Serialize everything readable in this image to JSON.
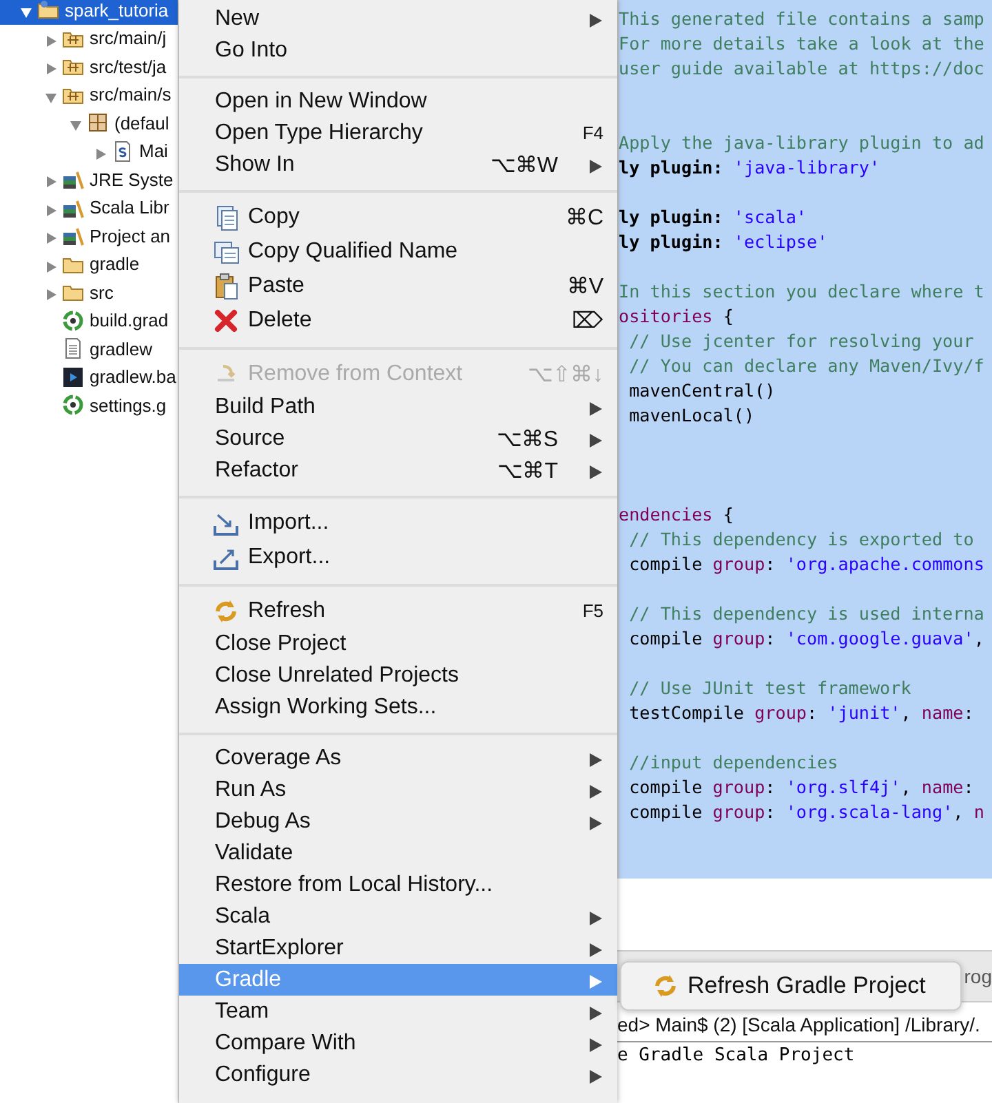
{
  "tree": [
    {
      "label": "spark_tutoria",
      "kind": "project",
      "selected": true,
      "expanded": true,
      "children": [
        {
          "label": "src/main/j",
          "kind": "package-folder",
          "selected": false,
          "expanded": false
        },
        {
          "label": "src/test/ja",
          "kind": "package-folder",
          "selected": false,
          "expanded": false
        },
        {
          "label": "src/main/s",
          "kind": "package-folder",
          "selected": false,
          "expanded": true,
          "children": [
            {
              "label": "(defaul",
              "kind": "package",
              "selected": false,
              "expanded": true,
              "children": [
                {
                  "label": "Mai",
                  "kind": "scala-file",
                  "selected": false,
                  "expanded": false
                }
              ]
            }
          ]
        },
        {
          "label": "JRE Syste",
          "kind": "library",
          "selected": false,
          "expanded": false
        },
        {
          "label": "Scala Libr",
          "kind": "library",
          "selected": false,
          "expanded": false
        },
        {
          "label": "Project an",
          "kind": "library",
          "selected": false,
          "expanded": false
        },
        {
          "label": "gradle",
          "kind": "folder",
          "selected": false,
          "expanded": false
        },
        {
          "label": "src",
          "kind": "folder",
          "selected": false,
          "expanded": false
        },
        {
          "label": "build.grad",
          "kind": "gradle-file",
          "selected": false
        },
        {
          "label": "gradlew",
          "kind": "text-file",
          "selected": false
        },
        {
          "label": "gradlew.ba",
          "kind": "script-file",
          "selected": false
        },
        {
          "label": "settings.g",
          "kind": "gradle-file",
          "selected": false
        }
      ]
    }
  ],
  "editor": {
    "lines": [
      {
        "kind": "code",
        "tokens": [
          {
            "kind": "comment",
            "text": "This generated file contains a samp"
          }
        ]
      },
      {
        "kind": "code",
        "tokens": [
          {
            "kind": "comment",
            "text": "For more details take a look at the"
          }
        ]
      },
      {
        "kind": "code",
        "tokens": [
          {
            "kind": "comment",
            "text": "user guide available at https://doc"
          }
        ]
      },
      {
        "kind": "blank"
      },
      {
        "kind": "blank"
      },
      {
        "kind": "code",
        "tokens": [
          {
            "kind": "comment",
            "text": "Apply the java-library plugin to ad"
          }
        ]
      },
      {
        "kind": "code",
        "tokens": [
          {
            "kind": "keyword",
            "text": "ly plugin: "
          },
          {
            "kind": "string",
            "text": "'java-library'"
          }
        ]
      },
      {
        "kind": "blank"
      },
      {
        "kind": "code",
        "tokens": [
          {
            "kind": "keyword",
            "text": "ly plugin: "
          },
          {
            "kind": "string",
            "text": "'scala'"
          }
        ]
      },
      {
        "kind": "code",
        "tokens": [
          {
            "kind": "keyword",
            "text": "ly plugin: "
          },
          {
            "kind": "string",
            "text": "'eclipse'"
          }
        ]
      },
      {
        "kind": "blank"
      },
      {
        "kind": "code",
        "tokens": [
          {
            "kind": "comment",
            "text": "In this section you declare where t"
          }
        ]
      },
      {
        "kind": "code",
        "tokens": [
          {
            "kind": "name",
            "text": "ositories"
          },
          {
            "kind": "plain",
            "text": " {"
          }
        ]
      },
      {
        "kind": "code",
        "tokens": [
          {
            "kind": "comment",
            "text": " // Use jcenter for resolving your"
          }
        ]
      },
      {
        "kind": "code",
        "tokens": [
          {
            "kind": "comment",
            "text": " // You can declare any Maven/Ivy/f"
          }
        ]
      },
      {
        "kind": "code",
        "tokens": [
          {
            "kind": "plain",
            "text": " mavenCentral()"
          }
        ]
      },
      {
        "kind": "code",
        "tokens": [
          {
            "kind": "plain",
            "text": " mavenLocal()"
          }
        ]
      },
      {
        "kind": "blank"
      },
      {
        "kind": "blank"
      },
      {
        "kind": "blank"
      },
      {
        "kind": "code",
        "tokens": [
          {
            "kind": "name",
            "text": "endencies"
          },
          {
            "kind": "plain",
            "text": " {"
          }
        ]
      },
      {
        "kind": "code",
        "tokens": [
          {
            "kind": "comment",
            "text": " // This dependency is exported to"
          }
        ]
      },
      {
        "kind": "code",
        "tokens": [
          {
            "kind": "plain",
            "text": " compile "
          },
          {
            "kind": "name",
            "text": "group"
          },
          {
            "kind": "plain",
            "text": ": "
          },
          {
            "kind": "string",
            "text": "'org.apache.commons"
          }
        ]
      },
      {
        "kind": "blank"
      },
      {
        "kind": "code",
        "tokens": [
          {
            "kind": "comment",
            "text": " // This dependency is used interna"
          }
        ]
      },
      {
        "kind": "code",
        "tokens": [
          {
            "kind": "plain",
            "text": " compile "
          },
          {
            "kind": "name",
            "text": "group"
          },
          {
            "kind": "plain",
            "text": ": "
          },
          {
            "kind": "string",
            "text": "'com.google.guava'"
          },
          {
            "kind": "plain",
            "text": ","
          }
        ]
      },
      {
        "kind": "blank"
      },
      {
        "kind": "code",
        "tokens": [
          {
            "kind": "comment",
            "text": " // Use JUnit test framework"
          }
        ]
      },
      {
        "kind": "code",
        "tokens": [
          {
            "kind": "plain",
            "text": " testCompile "
          },
          {
            "kind": "name",
            "text": "group"
          },
          {
            "kind": "plain",
            "text": ": "
          },
          {
            "kind": "string",
            "text": "'junit'"
          },
          {
            "kind": "plain",
            "text": ", "
          },
          {
            "kind": "name",
            "text": "name"
          },
          {
            "kind": "plain",
            "text": ":"
          }
        ]
      },
      {
        "kind": "blank"
      },
      {
        "kind": "code",
        "tokens": [
          {
            "kind": "comment",
            "text": " //input dependencies"
          }
        ]
      },
      {
        "kind": "code",
        "tokens": [
          {
            "kind": "plain",
            "text": " compile "
          },
          {
            "kind": "name",
            "text": "group"
          },
          {
            "kind": "plain",
            "text": ": "
          },
          {
            "kind": "string",
            "text": "'org.slf4j'"
          },
          {
            "kind": "plain",
            "text": ", "
          },
          {
            "kind": "name",
            "text": "name"
          },
          {
            "kind": "plain",
            "text": ":"
          }
        ]
      },
      {
        "kind": "code",
        "tokens": [
          {
            "kind": "plain",
            "text": " compile "
          },
          {
            "kind": "name",
            "text": "group"
          },
          {
            "kind": "plain",
            "text": ": "
          },
          {
            "kind": "string",
            "text": "'org.scala-lang'"
          },
          {
            "kind": "plain",
            "text": ", "
          },
          {
            "kind": "name",
            "text": "n"
          }
        ]
      }
    ]
  },
  "bottom_panel": {
    "tab_label": "rog",
    "console_header": "ed> Main$ (2) [Scala Application] /Library/.",
    "console_output": "e Gradle Scala Project"
  },
  "context_menu": {
    "items": [
      {
        "kind": "item",
        "label": "New",
        "submenu": true,
        "disabled": false,
        "selected": false
      },
      {
        "kind": "item",
        "label": "Go Into",
        "submenu": false,
        "disabled": false,
        "selected": false
      },
      {
        "kind": "separator"
      },
      {
        "kind": "item",
        "label": "Open in New Window",
        "submenu": false,
        "disabled": false,
        "selected": false
      },
      {
        "kind": "item",
        "label": "Open Type Hierarchy",
        "shortcut": "F4",
        "submenu": false,
        "disabled": false,
        "selected": false
      },
      {
        "kind": "item",
        "label": "Show In",
        "shortcut": "⌥⌘W",
        "submenu": true,
        "disabled": false,
        "selected": false
      },
      {
        "kind": "separator"
      },
      {
        "kind": "item",
        "label": "Copy",
        "shortcut": "⌘C",
        "submenu": false,
        "disabled": false,
        "selected": false
      },
      {
        "kind": "item",
        "label": "Copy Qualified Name",
        "submenu": false,
        "disabled": false,
        "selected": false
      },
      {
        "kind": "item",
        "label": "Paste",
        "shortcut": "⌘V",
        "submenu": false,
        "disabled": false,
        "selected": false
      },
      {
        "kind": "item",
        "label": "Delete",
        "shortcut": "⌦",
        "submenu": false,
        "disabled": false,
        "selected": false
      },
      {
        "kind": "separator"
      },
      {
        "kind": "item",
        "label": "Remove from Context",
        "shortcut": "⌥⇧⌘↓",
        "submenu": false,
        "disabled": true,
        "selected": false
      },
      {
        "kind": "item",
        "label": "Build Path",
        "submenu": true,
        "disabled": false,
        "selected": false
      },
      {
        "kind": "item",
        "label": "Source",
        "shortcut": "⌥⌘S",
        "submenu": true,
        "disabled": false,
        "selected": false
      },
      {
        "kind": "item",
        "label": "Refactor",
        "shortcut": "⌥⌘T",
        "submenu": true,
        "disabled": false,
        "selected": false
      },
      {
        "kind": "separator"
      },
      {
        "kind": "item",
        "label": "Import...",
        "submenu": false,
        "disabled": false,
        "selected": false
      },
      {
        "kind": "item",
        "label": "Export...",
        "submenu": false,
        "disabled": false,
        "selected": false
      },
      {
        "kind": "separator"
      },
      {
        "kind": "item",
        "label": "Refresh",
        "shortcut": "F5",
        "submenu": false,
        "disabled": false,
        "selected": false
      },
      {
        "kind": "item",
        "label": "Close Project",
        "submenu": false,
        "disabled": false,
        "selected": false
      },
      {
        "kind": "item",
        "label": "Close Unrelated Projects",
        "submenu": false,
        "disabled": false,
        "selected": false
      },
      {
        "kind": "item",
        "label": "Assign Working Sets...",
        "submenu": false,
        "disabled": false,
        "selected": false
      },
      {
        "kind": "separator"
      },
      {
        "kind": "item",
        "label": "Coverage As",
        "submenu": true,
        "disabled": false,
        "selected": false
      },
      {
        "kind": "item",
        "label": "Run As",
        "submenu": true,
        "disabled": false,
        "selected": false
      },
      {
        "kind": "item",
        "label": "Debug As",
        "submenu": true,
        "disabled": false,
        "selected": false
      },
      {
        "kind": "item",
        "label": "Validate",
        "submenu": false,
        "disabled": false,
        "selected": false
      },
      {
        "kind": "item",
        "label": "Restore from Local History...",
        "submenu": false,
        "disabled": false,
        "selected": false
      },
      {
        "kind": "item",
        "label": "Scala",
        "submenu": true,
        "disabled": false,
        "selected": false
      },
      {
        "kind": "item",
        "label": "StartExplorer",
        "submenu": true,
        "disabled": false,
        "selected": false
      },
      {
        "kind": "item",
        "label": "Gradle",
        "submenu": true,
        "disabled": false,
        "selected": true
      },
      {
        "kind": "item",
        "label": "Team",
        "submenu": true,
        "disabled": false,
        "selected": false
      },
      {
        "kind": "item",
        "label": "Compare With",
        "submenu": true,
        "disabled": false,
        "selected": false
      },
      {
        "kind": "item",
        "label": "Configure",
        "submenu": true,
        "disabled": false,
        "selected": false
      }
    ]
  },
  "submenu": {
    "items": [
      {
        "label": "Refresh Gradle Project",
        "selected": false
      }
    ]
  }
}
